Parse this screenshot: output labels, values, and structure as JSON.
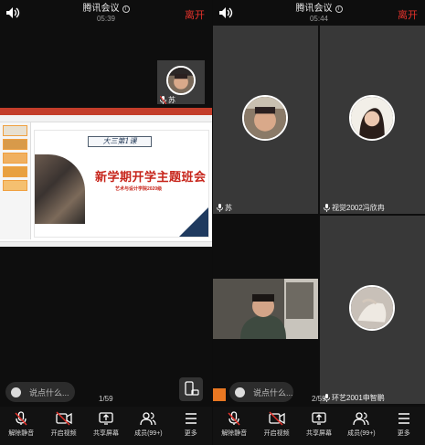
{
  "left": {
    "header": {
      "title": "腾讯会议",
      "time": "05:39",
      "leave": "离开"
    },
    "slide": {
      "lesson": "大三第1课",
      "headline": "新学期开学主题班会",
      "subtitle": "艺术与设计学院2020级"
    },
    "self_name": "苏",
    "chat_placeholder": "说点什么...",
    "page": "1/59"
  },
  "right": {
    "header": {
      "title": "腾讯会议",
      "time": "05:44",
      "leave": "离开"
    },
    "participants": [
      {
        "name": "苏"
      },
      {
        "name": "视觉2002冯欣冉"
      },
      {
        "name": "环艺2001申智鹏"
      }
    ],
    "chat_placeholder": "说点什么...",
    "page": "2/59"
  },
  "toolbar": [
    {
      "label": "解除静音",
      "icon": "mic-muted-icon"
    },
    {
      "label": "开启视频",
      "icon": "video-off-icon"
    },
    {
      "label": "共享屏幕",
      "icon": "share-screen-icon"
    },
    {
      "label": "成员(99+)",
      "icon": "members-icon"
    },
    {
      "label": "更多",
      "icon": "more-icon"
    }
  ],
  "colors": {
    "leave": "#e4322b",
    "slide_red": "#c7251b",
    "slide_navy": "#1f3a5f"
  }
}
